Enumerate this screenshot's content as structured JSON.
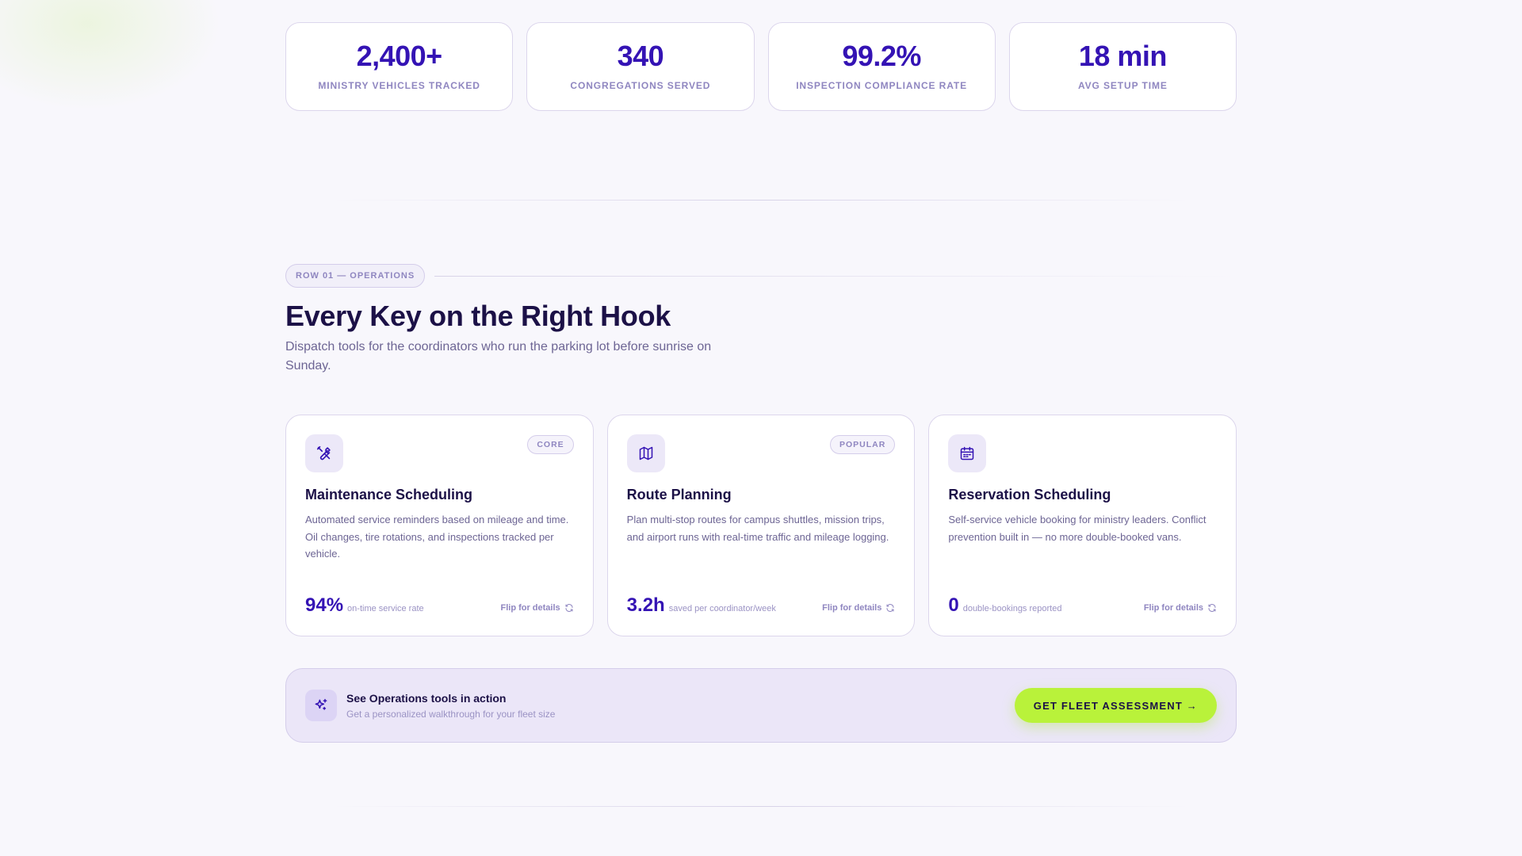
{
  "stats": [
    {
      "value": "2,400+",
      "label": "MINISTRY VEHICLES TRACKED"
    },
    {
      "value": "340",
      "label": "CONGREGATIONS SERVED"
    },
    {
      "value": "99.2%",
      "label": "INSPECTION COMPLIANCE RATE"
    },
    {
      "value": "18 min",
      "label": "AVG SETUP TIME"
    }
  ],
  "section": {
    "tag": "ROW 01 — OPERATIONS",
    "title": "Every Key on the Right Hook",
    "subtitle": "Dispatch tools for the coordinators who run the parking lot before sunrise on Sunday."
  },
  "cards": [
    {
      "icon": "wrench-screwdriver-icon",
      "badge": "CORE",
      "title": "Maintenance Scheduling",
      "description": "Automated service reminders based on mileage and time. Oil changes, tire rotations, and inspections tracked per vehicle.",
      "metric_value": "94%",
      "metric_label": "on-time service rate",
      "flip_label": "Flip for details"
    },
    {
      "icon": "map-icon",
      "badge": "POPULAR",
      "title": "Route Planning",
      "description": "Plan multi-stop routes for campus shuttles, mission trips, and airport runs with real-time traffic and mileage logging.",
      "metric_value": "3.2h",
      "metric_label": "saved per coordinator/week",
      "flip_label": "Flip for details"
    },
    {
      "icon": "calendar-icon",
      "badge": "",
      "title": "Reservation Scheduling",
      "description": "Self-service vehicle booking for ministry leaders. Conflict prevention built in — no more double-booked vans.",
      "metric_value": "0",
      "metric_label": "double-bookings reported",
      "flip_label": "Flip for details"
    }
  ],
  "cta": {
    "icon": "sparkles-icon",
    "title": "See Operations tools in action",
    "subtitle": "Get a personalized walkthrough for your fleet size",
    "button_label": "GET FLEET ASSESSMENT →"
  },
  "colors": {
    "accent": "#3413b4",
    "cta_button": "#b9f23a",
    "background": "#f8f7fc"
  }
}
